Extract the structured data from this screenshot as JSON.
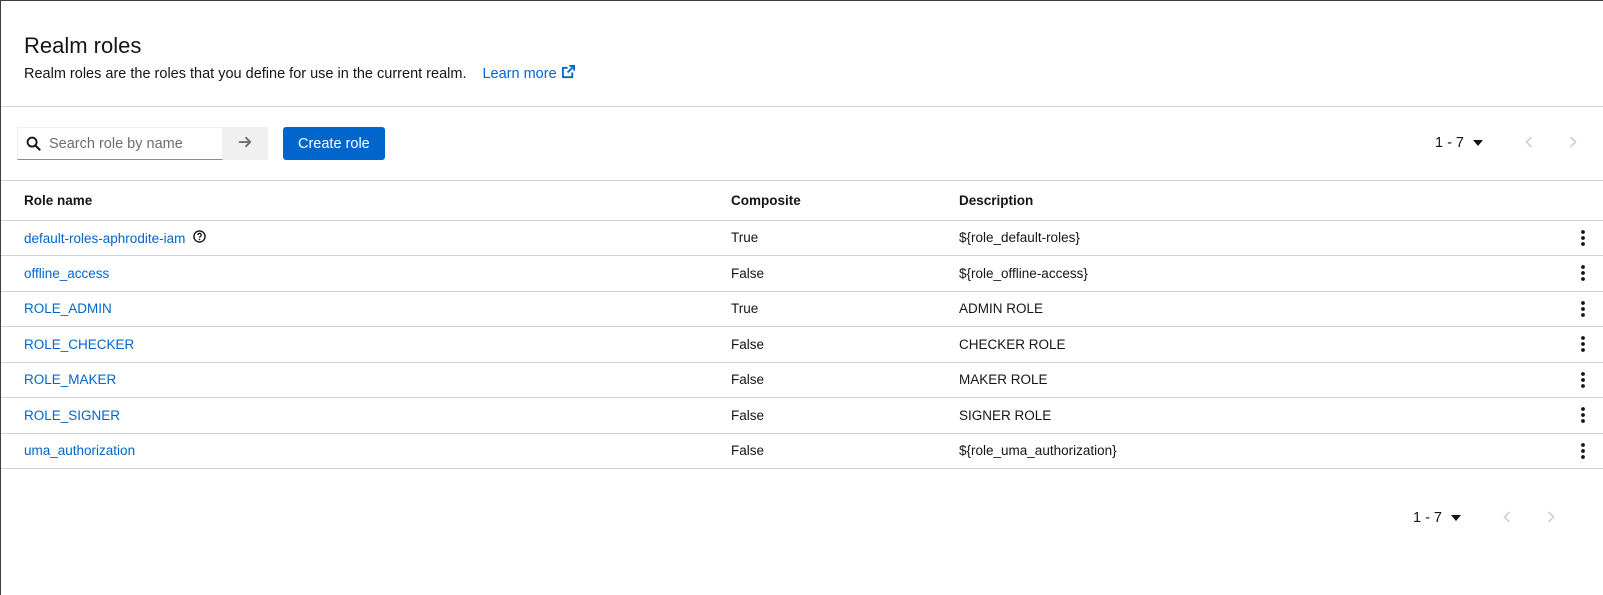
{
  "header": {
    "title": "Realm roles",
    "description": "Realm roles are the roles that you define for use in the current realm.",
    "learn_more": "Learn more"
  },
  "toolbar": {
    "search_placeholder": "Search role by name",
    "create_label": "Create role"
  },
  "pagination": {
    "range": "1 - 7"
  },
  "table": {
    "columns": [
      "Role name",
      "Composite",
      "Description"
    ],
    "rows": [
      {
        "name": "default-roles-aphrodite-iam",
        "composite": "True",
        "description": "${role_default-roles}"
      },
      {
        "name": "offline_access",
        "composite": "False",
        "description": "${role_offline-access}"
      },
      {
        "name": "ROLE_ADMIN",
        "composite": "True",
        "description": "ADMIN ROLE"
      },
      {
        "name": "ROLE_CHECKER",
        "composite": "False",
        "description": "CHECKER ROLE"
      },
      {
        "name": "ROLE_MAKER",
        "composite": "False",
        "description": "MAKER ROLE"
      },
      {
        "name": "ROLE_SIGNER",
        "composite": "False",
        "description": "SIGNER ROLE"
      },
      {
        "name": "uma_authorization",
        "composite": "False",
        "description": "${role_uma_authorization}"
      }
    ]
  },
  "icons": {
    "external_link": "external-link-icon",
    "search": "search-icon",
    "arrow_right": "arrow-right-icon",
    "caret_down": "caret-down-icon",
    "chevron_left": "chevron-left-icon",
    "chevron_right": "chevron-right-icon",
    "help": "question-circle-icon",
    "kebab": "kebab-menu-icon"
  },
  "colors": {
    "link": "#0066cc",
    "primary_button": "#0066cc",
    "border": "#d2d2d2",
    "disabled": "#d2d2d2"
  }
}
